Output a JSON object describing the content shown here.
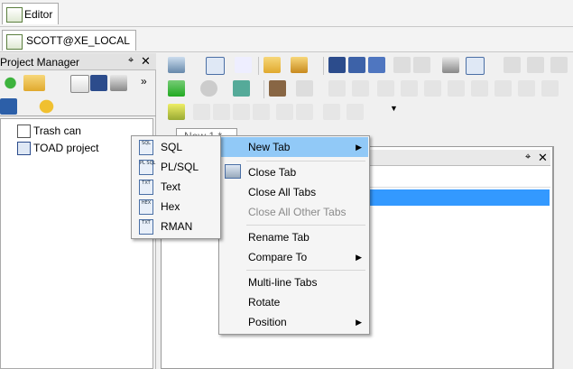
{
  "window": {
    "editor_tab": "Editor",
    "connection_tab": "SCOTT@XE_LOCAL"
  },
  "project_manager": {
    "title": "Project Manager",
    "pin_glyph": "⌖",
    "close_glyph": "✕",
    "tree": [
      {
        "label": "Trash can",
        "icon": "trash-can-icon"
      },
      {
        "label": "TOAD project",
        "icon": "toad-project-icon"
      }
    ]
  },
  "editor": {
    "tab_label": "New 1 *",
    "panel_pin": "⌖",
    "panel_close": "✕"
  },
  "context_menu": {
    "items": [
      {
        "label": "New Tab",
        "state": "highlighted",
        "submenu": true
      },
      {
        "label": "Close Tab",
        "state": "normal",
        "submenu": false
      },
      {
        "label": "Close All Tabs",
        "state": "normal",
        "submenu": false
      },
      {
        "label": "Close All Other Tabs",
        "state": "disabled",
        "submenu": false
      },
      {
        "label": "Rename Tab",
        "state": "normal",
        "submenu": false
      },
      {
        "label": "Compare To",
        "state": "normal",
        "submenu": true
      },
      {
        "label": "Multi-line Tabs",
        "state": "normal",
        "submenu": false
      },
      {
        "label": "Rotate",
        "state": "normal",
        "submenu": false
      },
      {
        "label": "Position",
        "state": "normal",
        "submenu": true
      }
    ],
    "arrow_glyph": "▶"
  },
  "new_tab_submenu": {
    "items": [
      {
        "label": "SQL",
        "icon": "sql-file-icon",
        "icon_text": "SQL"
      },
      {
        "label": "PL/SQL",
        "icon": "plsql-file-icon",
        "icon_text": "PL SQL"
      },
      {
        "label": "Text",
        "icon": "text-file-icon",
        "icon_text": "TXT"
      },
      {
        "label": "Hex",
        "icon": "hex-file-icon",
        "icon_text": "HEX"
      },
      {
        "label": "RMAN",
        "icon": "rman-file-icon",
        "icon_text": "TXT"
      }
    ]
  },
  "colors": {
    "highlight": "#91c9f7",
    "selection": "#3399ff"
  }
}
